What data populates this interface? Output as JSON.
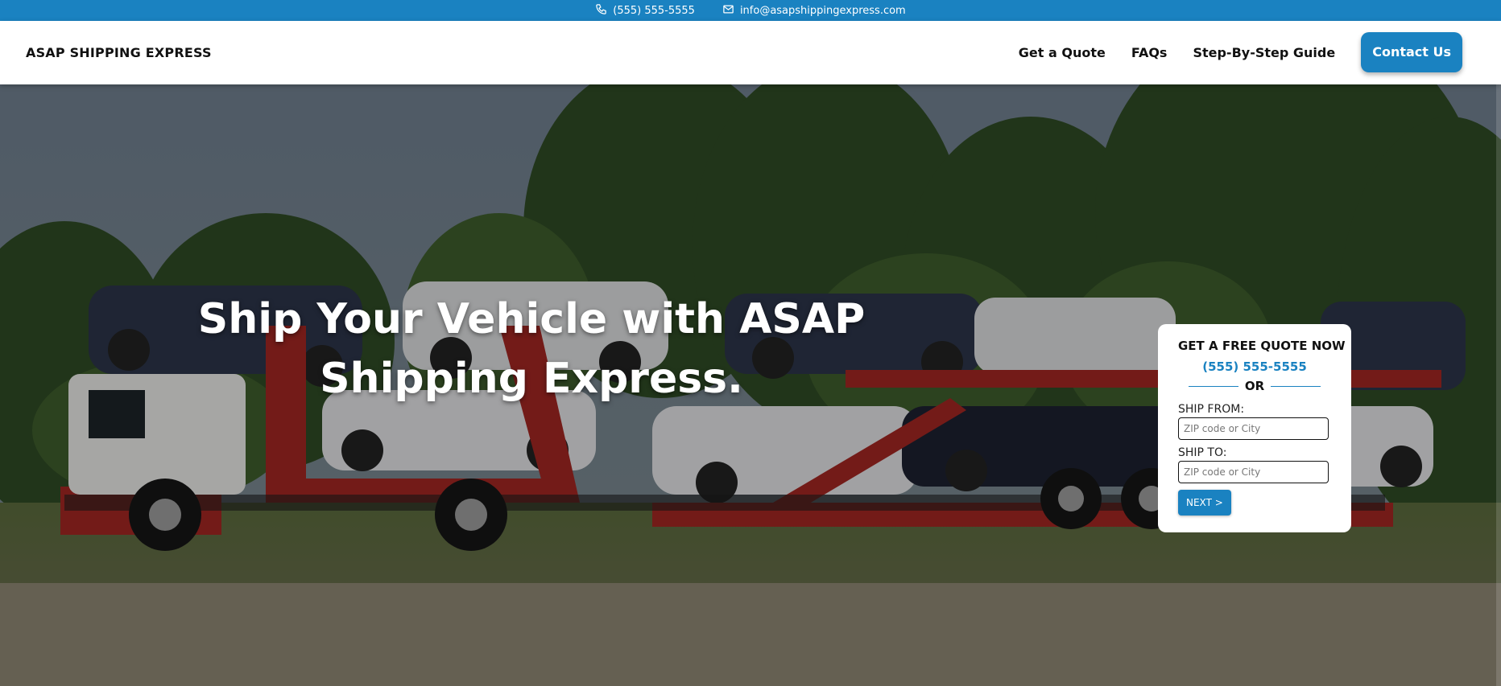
{
  "topbar": {
    "phone": "(555) 555-5555",
    "email": "info@asapshippingexpress.com",
    "phone_icon": "phone-icon",
    "email_icon": "mail-icon"
  },
  "header": {
    "brand": "ASAP SHIPPING EXPRESS",
    "nav": {
      "quote": "Get a Quote",
      "faqs": "FAQs",
      "guide": "Step-By-Step Guide",
      "contact": "Contact Us"
    }
  },
  "hero": {
    "headline": "Ship Your Vehicle with ASAP Shipping Express."
  },
  "quote_form": {
    "title": "GET A FREE QUOTE NOW",
    "phone": "(555) 555-5555",
    "or_text": "OR",
    "from_label": "SHIP FROM:",
    "from_placeholder": "ZIP code or City",
    "from_value": "",
    "to_label": "SHIP TO:",
    "to_placeholder": "ZIP code or City",
    "to_value": "",
    "next_label": "NEXT >"
  },
  "colors": {
    "accent": "#1a82c1",
    "header_bg": "#ffffff",
    "truck_red": "#c8302a"
  }
}
